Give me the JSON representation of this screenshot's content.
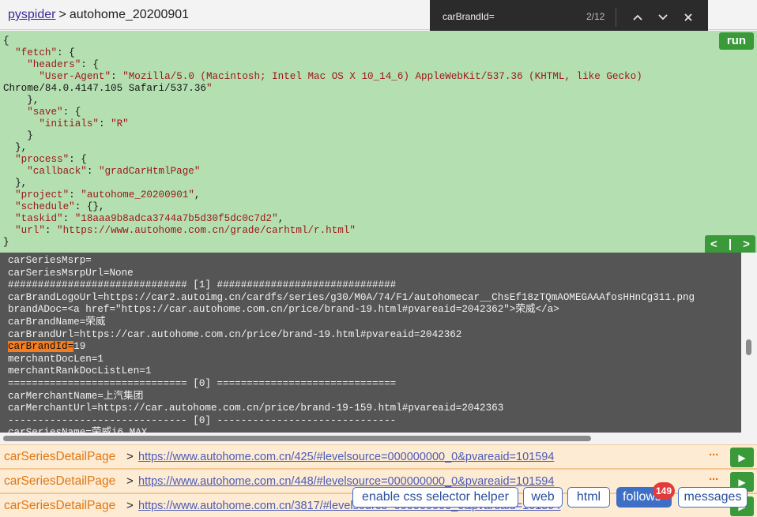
{
  "header": {
    "project_link": "pyspider",
    "separator": ">",
    "project_name": "autohome_20200901"
  },
  "find_bar": {
    "query": "carBrandId=",
    "count": "2/12"
  },
  "task_panel": {
    "run_label": "run",
    "prev_label": "<",
    "pager_sep": "|",
    "next_label": ">",
    "json_lines": [
      "{",
      "  \"fetch\": {",
      "    \"headers\": {",
      "      \"User-Agent\": \"Mozilla/5.0 (Macintosh; Intel Mac OS X 10_14_6) AppleWebKit/537.36 (KHTML, like Gecko)",
      "Chrome/84.0.4147.105 Safari/537.36\"",
      "    },",
      "    \"save\": {",
      "      \"initials\": \"R\"",
      "    }",
      "  },",
      "  \"process\": {",
      "    \"callback\": \"gradCarHtmlPage\"",
      "  },",
      "  \"project\": \"autohome_20200901\",",
      "  \"schedule\": {},",
      "  \"taskid\": \"18aaa9b8adca3744a7b5d30f5dc0c7d2\",",
      "  \"url\": \"https://www.autohome.com.cn/grade/carhtml/r.html\"",
      "}"
    ]
  },
  "console": {
    "lines_before": [
      "carSeriesMsrp=",
      "carSeriesMsrpUrl=None",
      "############################## [1] ##############################",
      "carBrandLogoUrl=https://car2.autoimg.cn/cardfs/series/g30/M0A/74/F1/autohomecar__ChsEf18zTQmAOMEGAAAfosHHnCg311.png",
      "brandADoc=<a href=\"https://car.autohome.com.cn/price/brand-19.html#pvareaid=2042362\">荣威</a>",
      "carBrandName=荣威",
      "carBrandUrl=https://car.autohome.com.cn/price/brand-19.html#pvareaid=2042362"
    ],
    "match_text": "carBrandId=",
    "match_rest": "19",
    "lines_after": [
      "merchantDocLen=1",
      "merchantRankDocListLen=1",
      "============================== [0] ==============================",
      "carMerchantName=上汽集团",
      "carMerchantUrl=https://car.autohome.com.cn/price/brand-19-159.html#pvareaid=2042363",
      "------------------------------ [0] ------------------------------",
      "carSeriesName=荣威i6 MAX"
    ]
  },
  "follows": [
    {
      "callback": "carSeriesDetailPage",
      "sep": ">",
      "url": "https://www.autohome.com.cn/425/#levelsource=000000000_0&pvareaid=101594",
      "more": "···",
      "play": "▶"
    },
    {
      "callback": "carSeriesDetailPage",
      "sep": ">",
      "url": "https://www.autohome.com.cn/448/#levelsource=000000000_0&pvareaid=101594",
      "more": "···",
      "play": "▶"
    },
    {
      "callback": "carSeriesDetailPage",
      "sep": ">",
      "url": "https://www.autohome.com.cn/3817/#levelsource=000000000_0&pvareaid=101594",
      "more": "···",
      "play": "▶"
    }
  ],
  "tabs": {
    "css_helper": "enable css selector helper",
    "web": "web",
    "html": "html",
    "follows": "follows",
    "follows_count": "149",
    "messages": "messages"
  },
  "colors": {
    "task_bg": "#b4e0b1",
    "console_bg": "#555555",
    "highlight": "#f57d20",
    "accent_green": "#3a9a3a",
    "tab_blue": "#3e6fc7",
    "follow_orange": "#e07712"
  }
}
